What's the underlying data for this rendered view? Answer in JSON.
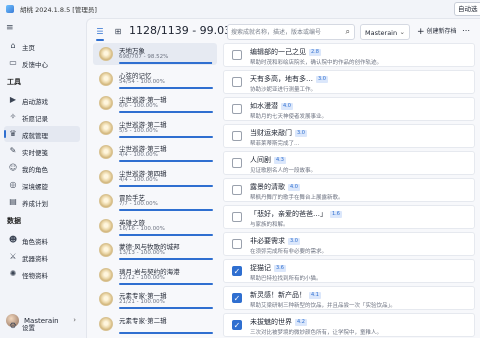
{
  "window": {
    "title": "胡桃 2024.1.8.5 [管理员]",
    "check_button": "自动选"
  },
  "sidebar": {
    "top_items": [
      {
        "label": "主页",
        "icon": "home-icon",
        "glyph": "⌂"
      },
      {
        "label": "反馈中心",
        "icon": "feedback-icon",
        "glyph": "▭"
      }
    ],
    "section_tools": "工具",
    "tool_items": [
      {
        "label": "启动游戏",
        "icon": "game-icon",
        "glyph": "▶"
      },
      {
        "label": "祈愿记录",
        "icon": "wish-icon",
        "glyph": "✧"
      },
      {
        "label": "成就管理",
        "icon": "trophy-icon",
        "glyph": "♛"
      },
      {
        "label": "实时便笺",
        "icon": "note-icon",
        "glyph": "✎"
      },
      {
        "label": "我的角色",
        "icon": "character-icon",
        "glyph": "☺"
      },
      {
        "label": "深境螺旋",
        "icon": "abyss-icon",
        "glyph": "◎"
      },
      {
        "label": "养成计划",
        "icon": "plan-icon",
        "glyph": "▤"
      }
    ],
    "section_data": "数据",
    "data_items": [
      {
        "label": "角色资料",
        "icon": "character-data-icon",
        "glyph": "☻"
      },
      {
        "label": "武器资料",
        "icon": "weapon-icon",
        "glyph": "⚔"
      },
      {
        "label": "怪物资料",
        "icon": "monster-icon",
        "glyph": "✺"
      }
    ],
    "user": {
      "name": "Masterain"
    },
    "settings_label": "设置"
  },
  "toolbar": {
    "progress": "1128/1139 - 99.03%",
    "search_placeholder": "搜索成就名称，描述，版本或编号",
    "archive_select": "Masterain",
    "new_archive": "创建新存档"
  },
  "categories": [
    {
      "name": "天地万象",
      "stat": "698/707 - 98.52%",
      "progress": 0.9852
    },
    {
      "name": "心弦的记忆",
      "stat": "54/54 - 100.00%",
      "progress": 1
    },
    {
      "name": "尘世巡游·第一辑",
      "stat": "6/6 - 100.00%",
      "progress": 1
    },
    {
      "name": "尘世巡游·第二辑",
      "stat": "5/5 - 100.00%",
      "progress": 1
    },
    {
      "name": "尘世巡游·第三辑",
      "stat": "4/4 - 100.00%",
      "progress": 1
    },
    {
      "name": "尘世巡游·第四辑",
      "stat": "4/4 - 100.00%",
      "progress": 1
    },
    {
      "name": "冒险手艺",
      "stat": "7/7 - 100.00%",
      "progress": 1
    },
    {
      "name": "英雄之旅",
      "stat": "16/16 - 100.00%",
      "progress": 1
    },
    {
      "name": "蒙德·风与牧歌的城邦",
      "stat": "13/13 - 100.00%",
      "progress": 1
    },
    {
      "name": "璃月·岩与契约的海港",
      "stat": "12/12 - 100.00%",
      "progress": 1
    },
    {
      "name": "元素专家·第一辑",
      "stat": "21/21 - 100.00%",
      "progress": 1
    },
    {
      "name": "元素专家·第二辑",
      "stat": "",
      "progress": 1
    }
  ],
  "achievements": [
    {
      "title": "编辑部的一己之见",
      "version": "2.8",
      "desc": "帮助时茂和彩绘店院长，确认院中的作品的创作轨迹。",
      "done": false
    },
    {
      "title": "天有多高，地有多…",
      "version": "3.0",
      "desc": "协助沙妮亚进行测量工作。",
      "done": false
    },
    {
      "title": "如水漫潜",
      "version": "4.0",
      "desc": "帮助月的七天神使者发展事业。",
      "done": false
    },
    {
      "title": "当财运来敲门",
      "version": "3.0",
      "desc": "帮菲莱蒂斯完成了…",
      "done": false
    },
    {
      "title": "人间剧",
      "version": "4.3",
      "desc": "见证歌剧名人的一段故事。",
      "done": false
    },
    {
      "title": "露景的清歌",
      "version": "4.0",
      "desc": "帮枫丹舞厅的歌手在舞台上展露新歌。",
      "done": false
    },
    {
      "title": "「悲好，亲爱的爸爸…」",
      "version": "1.6",
      "desc": "与家族的和解。",
      "done": false
    },
    {
      "title": "非必要需求",
      "version": "3.0",
      "desc": "在须弥完成所有非必要的需求。",
      "done": false
    },
    {
      "title": "捉猫记",
      "version": "3.6",
      "desc": "帮助巴特拉找到所有的小猫。",
      "done": true
    },
    {
      "title": "新灵感！新产品！",
      "version": "4.1",
      "desc": "帮助艾梁研制三种新型的饮品，并且品尝一次「实验饮品」。",
      "done": true
    },
    {
      "title": "未拔魅的世界",
      "version": "4.2",
      "desc": "三次对比被梦境的微妙颜色所有，让学院中，童稚人。",
      "done": true
    }
  ]
}
